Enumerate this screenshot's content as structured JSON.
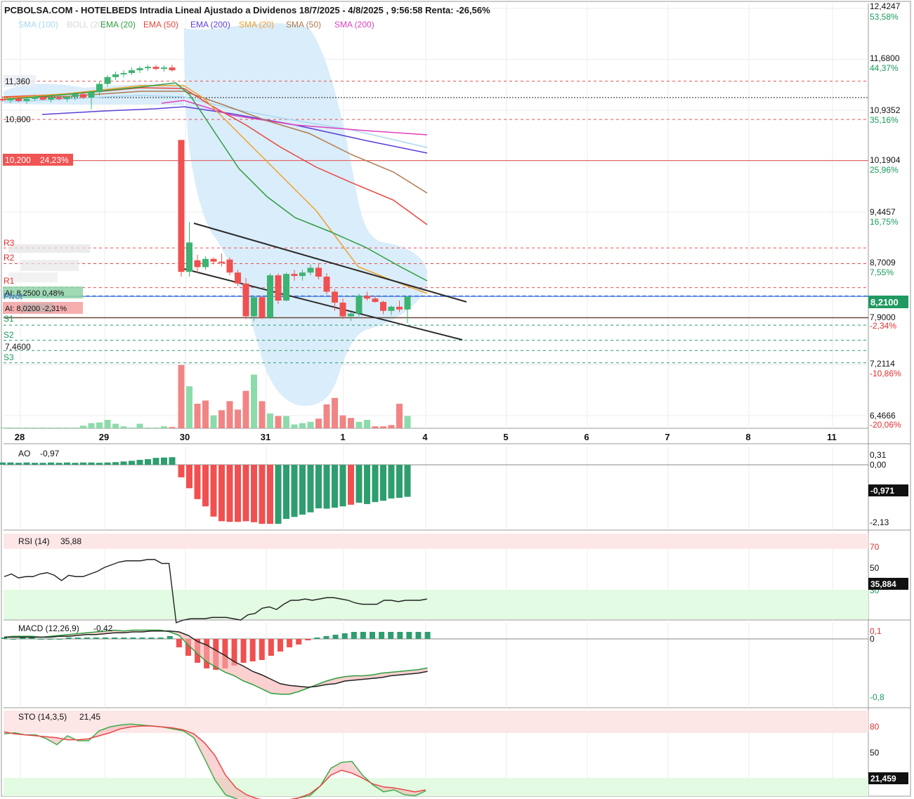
{
  "header": {
    "title": "PCBOLSA.COM - HOTELBEDS Intradia Lineal Ajustado a Dividenos 18/7/2025 - 4/8/2025 , 9:56:58 Renta: -26,56%"
  },
  "colors": {
    "sma100": "#a8d8f0",
    "boll": "#d8d8d8",
    "ema20": "#2e9e3e",
    "ema50": "#e8453c",
    "ema200": "#5b3fd6",
    "sma20": "#f0a030",
    "sma50": "#b07a50",
    "sma200": "#e040c0",
    "up": "#3cb371",
    "down": "#f05050",
    "bollfill": "#d6ebfa"
  },
  "legend": [
    {
      "label": "SMA (100)",
      "color": "#a8d8f0"
    },
    {
      "label": "BOLL (20)",
      "color": "#d8d8d8"
    },
    {
      "label": "EMA (20)",
      "color": "#2e9e3e"
    },
    {
      "label": "EMA (50)",
      "color": "#e8453c"
    },
    {
      "label": "EMA (200)",
      "color": "#5b3fd6"
    },
    {
      "label": "SMA (20)",
      "color": "#f0a030"
    },
    {
      "label": "SMA (50)",
      "color": "#b07a50"
    },
    {
      "label": "SMA (200)",
      "color": "#e040c0"
    }
  ],
  "levels": {
    "lab_11360": "11,360",
    "lab_10800": "10,800",
    "lab_10200": "10,200",
    "lab_10200_pct": "24,23%",
    "r3": "R3",
    "r2": "R2",
    "r1": "R1",
    "pivot": "Pivot",
    "s1": "S1",
    "s2": "S2",
    "s3": "S3",
    "ai_upper": "AI: 8,2500  0,48%",
    "ai_lower": "AI: 8,0200 -2,31%",
    "lab_7460": "7,4600"
  },
  "chart_data": [
    {
      "type": "candlestick",
      "name": "price",
      "y_axis": [
        {
          "value": "12,4247",
          "pct": "53,58%"
        },
        {
          "value": "11,6800",
          "pct": "44,37%"
        },
        {
          "value": "10,9352",
          "pct": "35,16%"
        },
        {
          "value": "10,1904",
          "pct": "25,96%"
        },
        {
          "value": "9,4457",
          "pct": "16,75%"
        },
        {
          "value": "8,7009",
          "pct": "7,55%"
        },
        {
          "value": "7,9000",
          "pct": "-2,34%"
        },
        {
          "value": "7,2114",
          "pct": "-10,86%"
        },
        {
          "value": "6,4666",
          "pct": "-20,06%"
        }
      ],
      "last_price": "8,2100",
      "x_labels": [
        "28",
        "29",
        "30",
        "31",
        "1",
        "4",
        "5",
        "6",
        "7",
        "8",
        "11"
      ],
      "candles": [
        [
          11.1,
          11.14,
          11.06,
          11.08
        ],
        [
          11.08,
          11.12,
          11.04,
          11.11
        ],
        [
          11.11,
          11.13,
          11.05,
          11.07
        ],
        [
          11.07,
          11.11,
          11.03,
          11.1
        ],
        [
          11.1,
          11.16,
          11.07,
          11.13
        ],
        [
          11.13,
          11.16,
          11.08,
          11.09
        ],
        [
          11.09,
          11.13,
          11.05,
          11.12
        ],
        [
          11.12,
          11.15,
          11.08,
          11.1
        ],
        [
          11.1,
          11.14,
          11.06,
          11.13
        ],
        [
          11.13,
          11.2,
          11.08,
          11.17
        ],
        [
          11.17,
          11.21,
          11.1,
          11.12
        ],
        [
          11.12,
          11.22,
          10.95,
          11.2
        ],
        [
          11.2,
          11.35,
          11.15,
          11.32
        ],
        [
          11.32,
          11.45,
          11.28,
          11.42
        ],
        [
          11.42,
          11.5,
          11.38,
          11.46
        ],
        [
          11.46,
          11.52,
          11.42,
          11.48
        ],
        [
          11.48,
          11.56,
          11.45,
          11.52
        ],
        [
          11.52,
          11.58,
          11.48,
          11.55
        ],
        [
          11.55,
          11.6,
          11.51,
          11.57
        ],
        [
          11.57,
          11.6,
          11.52,
          11.54
        ],
        [
          11.54,
          11.59,
          11.5,
          11.56
        ],
        [
          11.56,
          11.6,
          11.5,
          11.52
        ],
        [
          10.5,
          10.5,
          8.5,
          8.57
        ],
        [
          8.57,
          9.3,
          8.5,
          9.0
        ],
        [
          8.74,
          8.82,
          8.55,
          8.64
        ],
        [
          8.64,
          8.8,
          8.6,
          8.76
        ],
        [
          8.76,
          8.78,
          8.68,
          8.72
        ],
        [
          8.72,
          8.84,
          8.65,
          8.7
        ],
        [
          8.75,
          8.78,
          8.52,
          8.56
        ],
        [
          8.56,
          8.6,
          8.36,
          8.4
        ],
        [
          8.4,
          8.48,
          7.88,
          7.92
        ],
        [
          7.92,
          8.2,
          7.85,
          8.2
        ],
        [
          8.2,
          8.22,
          7.88,
          7.9
        ],
        [
          7.9,
          8.55,
          7.88,
          8.52
        ],
        [
          8.52,
          8.55,
          8.1,
          8.15
        ],
        [
          8.15,
          8.56,
          8.14,
          8.54
        ],
        [
          8.54,
          8.6,
          8.44,
          8.51
        ],
        [
          8.51,
          8.6,
          8.44,
          8.56
        ],
        [
          8.56,
          8.68,
          8.52,
          8.63
        ],
        [
          8.63,
          8.7,
          8.46,
          8.5
        ],
        [
          8.5,
          8.55,
          8.24,
          8.28
        ],
        [
          8.28,
          8.32,
          8.0,
          8.12
        ],
        [
          8.12,
          8.18,
          7.88,
          7.92
        ],
        [
          7.92,
          7.98,
          7.85,
          7.96
        ],
        [
          7.96,
          8.25,
          7.92,
          8.22
        ],
        [
          8.22,
          8.28,
          8.15,
          8.18
        ],
        [
          8.18,
          8.22,
          8.12,
          8.13
        ],
        [
          8.13,
          8.15,
          7.95,
          8.0
        ],
        [
          8.0,
          8.08,
          7.94,
          8.06
        ],
        [
          8.06,
          8.15,
          7.98,
          8.02
        ],
        [
          8.02,
          8.21,
          7.82,
          8.21
        ]
      ],
      "volume": [
        [
          0,
          0.005,
          "g"
        ],
        [
          1,
          0.004,
          "g"
        ],
        [
          2,
          0.005,
          "g"
        ],
        [
          3,
          0.004,
          "g"
        ],
        [
          4,
          0.005,
          "g"
        ],
        [
          5,
          0.004,
          "g"
        ],
        [
          6,
          0.006,
          "g"
        ],
        [
          7,
          0.005,
          "g"
        ],
        [
          8,
          0.004,
          "g"
        ],
        [
          9,
          0.006,
          "g"
        ],
        [
          10,
          0.04,
          "g"
        ],
        [
          11,
          0.08,
          "g"
        ],
        [
          12,
          0.09,
          "g"
        ],
        [
          13,
          0.13,
          "g"
        ],
        [
          14,
          0.07,
          "g"
        ],
        [
          15,
          0.03,
          "g"
        ],
        [
          16,
          0.005,
          "g"
        ],
        [
          17,
          0.07,
          "g"
        ],
        [
          18,
          0.01,
          "g"
        ],
        [
          19,
          0.005,
          "g"
        ],
        [
          20,
          0.03,
          "g"
        ],
        [
          21,
          0.02,
          "r"
        ],
        [
          22,
          0.98,
          "r"
        ],
        [
          23,
          0.65,
          "g"
        ],
        [
          24,
          0.38,
          "r"
        ],
        [
          25,
          0.43,
          "r"
        ],
        [
          26,
          0.2,
          "g"
        ],
        [
          27,
          0.28,
          "r"
        ],
        [
          28,
          0.42,
          "r"
        ],
        [
          29,
          0.29,
          "r"
        ],
        [
          30,
          0.58,
          "r"
        ],
        [
          31,
          0.83,
          "g"
        ],
        [
          32,
          0.42,
          "r"
        ],
        [
          33,
          0.23,
          "g"
        ],
        [
          34,
          0.19,
          "r"
        ],
        [
          35,
          0.19,
          "g"
        ],
        [
          36,
          0.06,
          "g"
        ],
        [
          37,
          0.08,
          "g"
        ],
        [
          38,
          0.1,
          "g"
        ],
        [
          39,
          0.15,
          "r"
        ],
        [
          40,
          0.37,
          "r"
        ],
        [
          41,
          0.47,
          "r"
        ],
        [
          42,
          0.2,
          "r"
        ],
        [
          43,
          0.16,
          "r"
        ],
        [
          44,
          0.1,
          "g"
        ],
        [
          45,
          0.13,
          "g"
        ],
        [
          46,
          0.03,
          "r"
        ],
        [
          47,
          0.03,
          "r"
        ],
        [
          48,
          0.05,
          "r"
        ],
        [
          49,
          0.38,
          "r"
        ],
        [
          50,
          0.19,
          "g"
        ]
      ]
    },
    {
      "type": "bar",
      "name": "AO",
      "label": "AO",
      "value": "-0,97",
      "y_axis": [
        "0,31",
        "0,00",
        "-2,13"
      ],
      "last": "-0,971",
      "values": [
        0.07,
        0.07,
        0.06,
        0.07,
        0.06,
        0.06,
        0.07,
        0.06,
        0.07,
        0.06,
        0.07,
        0.07,
        0.06,
        0.07,
        0.08,
        0.1,
        0.12,
        0.15,
        0.17,
        0.21,
        0.22,
        0.23,
        -0.38,
        -0.71,
        -1.04,
        -1.26,
        -1.57,
        -1.71,
        -1.73,
        -1.73,
        -1.71,
        -1.74,
        -1.79,
        -1.79,
        -1.79,
        -1.64,
        -1.58,
        -1.51,
        -1.44,
        -1.32,
        -1.33,
        -1.3,
        -1.26,
        -1.21,
        -1.15,
        -1.19,
        -1.13,
        -1.09,
        -1.02,
        -1.0,
        -0.97
      ],
      "colors": [
        "g",
        "g",
        "g",
        "g",
        "g",
        "g",
        "g",
        "g",
        "g",
        "g",
        "g",
        "g",
        "g",
        "g",
        "g",
        "g",
        "g",
        "g",
        "g",
        "g",
        "g",
        "g",
        "r",
        "r",
        "r",
        "r",
        "r",
        "r",
        "r",
        "r",
        "r",
        "r",
        "r",
        "r",
        "g",
        "g",
        "g",
        "g",
        "g",
        "g",
        "g",
        "g",
        "g",
        "r",
        "g",
        "g",
        "g",
        "g",
        "g",
        "g",
        "g"
      ]
    },
    {
      "type": "line",
      "name": "RSI",
      "label": "RSI (14)",
      "value": "35,88",
      "y_axis": [
        "70",
        "50",
        "30"
      ],
      "last": "35,884",
      "values": [
        58,
        60,
        57,
        58,
        58,
        60,
        61,
        59,
        55,
        59,
        58,
        58,
        60,
        62,
        65,
        67,
        69,
        70,
        70,
        70,
        71,
        71,
        68,
        68,
        23,
        25,
        26,
        26,
        26,
        27,
        27,
        27,
        26,
        25,
        29,
        30,
        34,
        35,
        33,
        37,
        40,
        40,
        41,
        40,
        41,
        42,
        42,
        41,
        40,
        38,
        37,
        37,
        37,
        40,
        40,
        39,
        40,
        40,
        40,
        41
      ]
    },
    {
      "type": "line",
      "name": "MACD",
      "label": "MACD (12,26,9)",
      "value": "-0,42",
      "y_axis": [
        "0,1",
        "0",
        "-0,8"
      ],
      "macd": [
        0.02,
        0.03,
        0.03,
        0.03,
        0.02,
        0.03,
        0.04,
        0.05,
        0.06,
        0.07,
        0.08,
        0.09,
        0.1,
        0.09,
        0.1,
        0.1,
        0.1,
        0.1,
        0.08,
        0.04,
        -0.07,
        -0.17,
        -0.26,
        -0.32,
        -0.38,
        -0.42,
        -0.48,
        -0.52,
        -0.57,
        -0.62,
        -0.63,
        -0.63,
        -0.6,
        -0.56,
        -0.52,
        -0.48,
        -0.45,
        -0.43,
        -0.42,
        -0.42,
        -0.41,
        -0.39,
        -0.38,
        -0.37,
        -0.36,
        -0.35,
        -0.33
      ],
      "signal": [
        0.02,
        0.02,
        0.02,
        0.02,
        0.02,
        0.02,
        0.03,
        0.03,
        0.04,
        0.05,
        0.05,
        0.06,
        0.07,
        0.07,
        0.08,
        0.08,
        0.09,
        0.09,
        0.09,
        0.08,
        0.04,
        -0.03,
        -0.07,
        -0.13,
        -0.19,
        -0.26,
        -0.31,
        -0.37,
        -0.41,
        -0.46,
        -0.51,
        -0.53,
        -0.54,
        -0.55,
        -0.54,
        -0.52,
        -0.51,
        -0.48,
        -0.47,
        -0.46,
        -0.45,
        -0.44,
        -0.42,
        -0.41,
        -0.4,
        -0.39,
        -0.37
      ],
      "hist": [
        0.01,
        0.0,
        0.01,
        0.01,
        0.0,
        0.0,
        0.0,
        0.01,
        0.01,
        0.01,
        0.01,
        0.01,
        0.01,
        0.01,
        0.01,
        0.01,
        0.01,
        0.01,
        0.02,
        -0.06,
        -0.12,
        -0.17,
        -0.21,
        -0.22,
        -0.21,
        -0.19,
        -0.17,
        -0.16,
        -0.15,
        -0.12,
        -0.09,
        -0.06,
        -0.04,
        -0.01,
        0.01,
        0.02,
        0.03,
        0.04,
        0.05,
        0.05,
        0.05,
        0.05,
        0.05,
        0.05,
        0.05,
        0.05,
        0.05
      ]
    },
    {
      "type": "line",
      "name": "STO",
      "label": "STO (14,3,5)",
      "value": "21,45",
      "y_axis": [
        "80",
        "50",
        "20"
      ],
      "last": "21,459",
      "k": [
        77,
        78,
        76,
        76,
        72,
        66,
        75,
        70,
        70,
        80,
        84,
        86,
        87,
        86,
        85,
        84,
        82,
        80,
        73,
        52,
        30,
        15,
        11,
        7,
        6,
        5,
        6,
        8,
        12,
        14,
        24,
        42,
        48,
        49,
        35,
        25,
        18,
        20,
        15,
        14,
        19
      ],
      "d": [
        79,
        77,
        76,
        75,
        74,
        73,
        71,
        71,
        72,
        75,
        78,
        82,
        84,
        85,
        85,
        84,
        83,
        81,
        77,
        68,
        55,
        35,
        22,
        15,
        11,
        9,
        9,
        10,
        12,
        16,
        24,
        35,
        40,
        37,
        32,
        26,
        23,
        22,
        20,
        18,
        20
      ]
    }
  ]
}
